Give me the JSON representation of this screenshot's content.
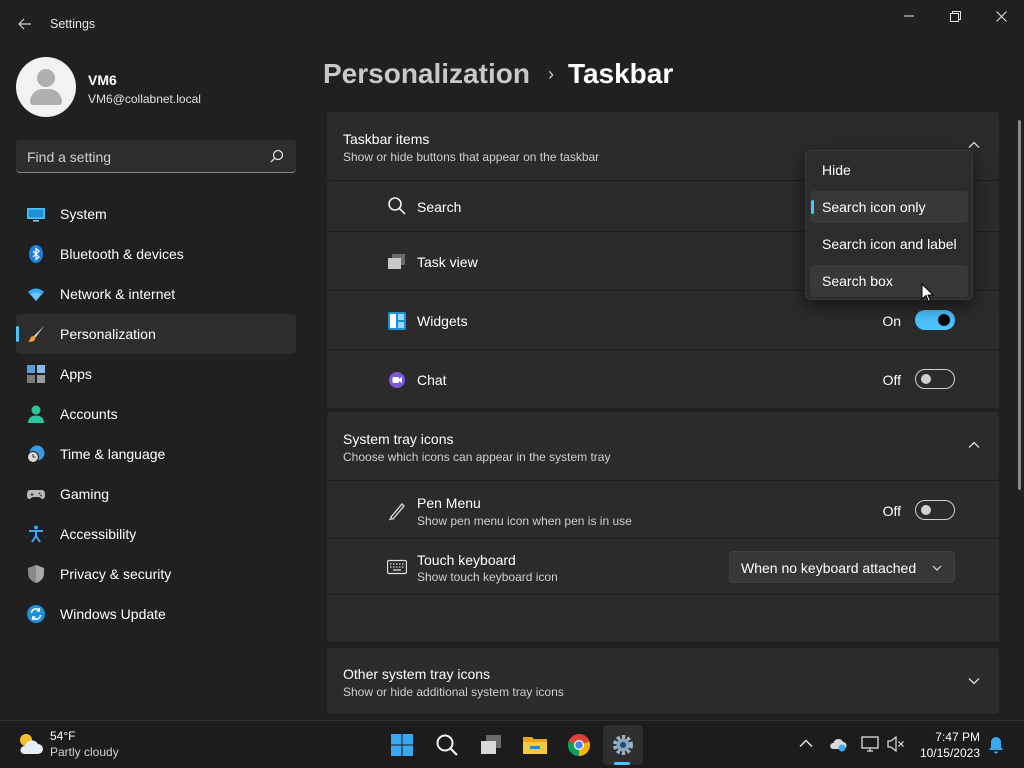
{
  "window": {
    "title": "Settings",
    "back_icon": "back-arrow-icon",
    "controls": [
      "minimize-icon",
      "restore-icon",
      "close-icon"
    ]
  },
  "user": {
    "name": "VM6",
    "email": "VM6@collabnet.local"
  },
  "search": {
    "placeholder": "Find a setting",
    "icon": "search-icon"
  },
  "sidebar": {
    "items": [
      {
        "label": "System",
        "icon": "system-icon",
        "active": false
      },
      {
        "label": "Bluetooth & devices",
        "icon": "bluetooth-icon",
        "active": false
      },
      {
        "label": "Network & internet",
        "icon": "wifi-icon",
        "active": false
      },
      {
        "label": "Personalization",
        "icon": "brush-icon",
        "active": true
      },
      {
        "label": "Apps",
        "icon": "apps-icon",
        "active": false
      },
      {
        "label": "Accounts",
        "icon": "accounts-icon",
        "active": false
      },
      {
        "label": "Time & language",
        "icon": "clock-globe-icon",
        "active": false
      },
      {
        "label": "Gaming",
        "icon": "gamepad-icon",
        "active": false
      },
      {
        "label": "Accessibility",
        "icon": "accessibility-icon",
        "active": false
      },
      {
        "label": "Privacy & security",
        "icon": "shield-icon",
        "active": false
      },
      {
        "label": "Windows Update",
        "icon": "update-icon",
        "active": false
      }
    ]
  },
  "breadcrumb": {
    "parent": "Personalization",
    "separator": "›",
    "current": "Taskbar"
  },
  "taskbar_items": {
    "title": "Taskbar items",
    "subtitle": "Show or hide buttons that appear on the taskbar",
    "rows": [
      {
        "label": "Search",
        "icon": "search-icon"
      },
      {
        "label": "Task view",
        "icon": "task-view-icon"
      },
      {
        "label": "Widgets",
        "icon": "widgets-icon",
        "state": "On",
        "on": true
      },
      {
        "label": "Chat",
        "icon": "chat-icon",
        "state": "Off",
        "on": false
      }
    ]
  },
  "search_menu": {
    "options": [
      "Hide",
      "Search icon only",
      "Search icon and label",
      "Search box"
    ],
    "selected": "Search icon only",
    "hovered": "Search box"
  },
  "system_tray": {
    "title": "System tray icons",
    "subtitle": "Choose which icons can appear in the system tray",
    "pen_menu": {
      "label": "Pen Menu",
      "sub": "Show pen menu icon when pen is in use",
      "state": "Off",
      "on": false,
      "icon": "pen-icon"
    },
    "touch_keyboard": {
      "label": "Touch keyboard",
      "sub": "Show touch keyboard icon",
      "value": "When no keyboard attached",
      "icon": "keyboard-icon"
    }
  },
  "other_tray": {
    "title": "Other system tray icons",
    "subtitle": "Show or hide additional system tray icons"
  },
  "os_taskbar": {
    "weather": {
      "temp": "54°F",
      "desc": "Partly cloudy",
      "icon": "partly-cloudy-icon"
    },
    "apps": [
      "start-icon",
      "search-icon",
      "task-view-icon",
      "file-explorer-icon",
      "chrome-icon",
      "settings-icon"
    ],
    "clock": {
      "time": "7:47 PM",
      "date": "10/15/2023"
    },
    "tray": [
      "chevron-up-icon",
      "onedrive-icon",
      "display-icon",
      "volume-muted-icon",
      "bell-icon"
    ]
  },
  "colors": {
    "accent": "#4cc2ff",
    "background": "#202020",
    "card": "#2b2b2b"
  }
}
